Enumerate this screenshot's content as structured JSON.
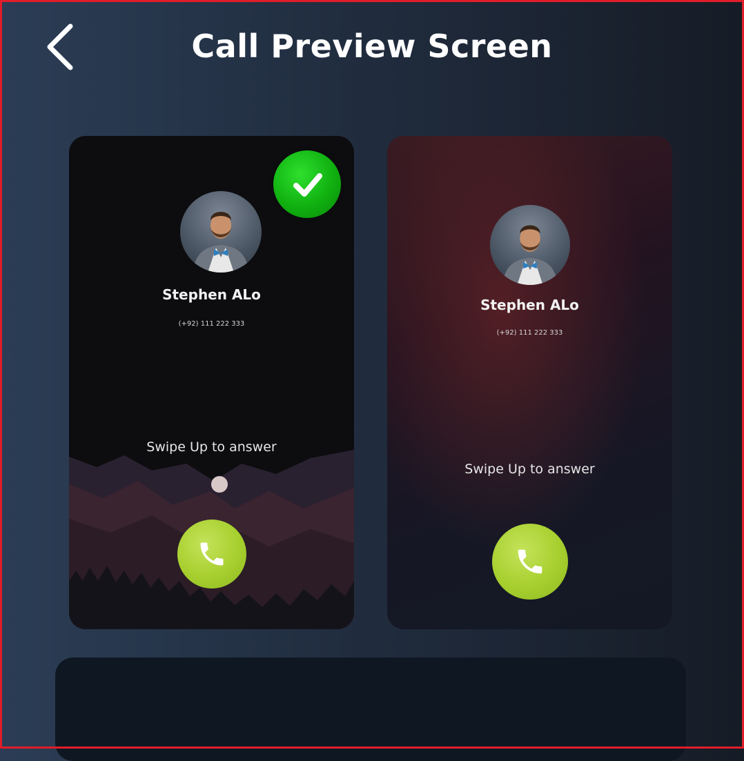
{
  "header": {
    "title": "Call Preview Screen",
    "back_icon": "chevron-left-icon"
  },
  "previews": [
    {
      "name": "Stephen ALo",
      "phone": "(+92) 111 222 333",
      "swipe_text": "Swipe Up to answer",
      "selected": true
    },
    {
      "name": "Stephen ALo",
      "phone": "(+92) 111 222 333",
      "swipe_text": "Swipe Up to answer",
      "selected": false
    }
  ],
  "colors": {
    "accent_green": "#10b010",
    "answer_green": "#a7cf2e",
    "frame_red": "#e11d2a"
  }
}
